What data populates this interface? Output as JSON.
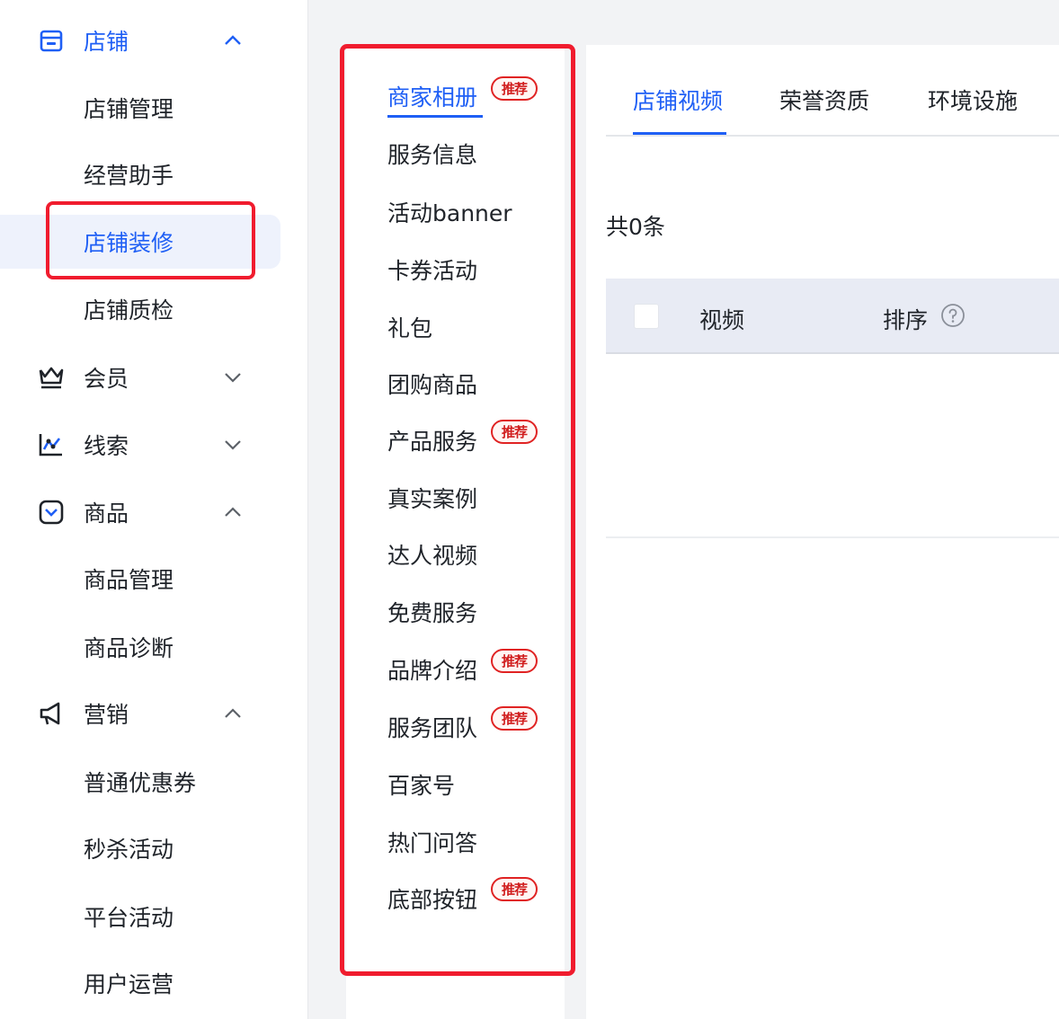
{
  "sidebar": {
    "groups": [
      {
        "label": "店铺",
        "icon": "store-icon",
        "expanded": true,
        "items": [
          {
            "label": "店铺管理"
          },
          {
            "label": "经营助手"
          },
          {
            "label": "店铺装修",
            "selected": true
          },
          {
            "label": "店铺质检"
          }
        ]
      },
      {
        "label": "会员",
        "icon": "crown-icon",
        "expanded": false
      },
      {
        "label": "线索",
        "icon": "chart-icon",
        "expanded": false
      },
      {
        "label": "商品",
        "icon": "product-icon",
        "expanded": true,
        "items": [
          {
            "label": "商品管理"
          },
          {
            "label": "商品诊断"
          }
        ]
      },
      {
        "label": "营销",
        "icon": "megaphone-icon",
        "expanded": true,
        "items": [
          {
            "label": "普通优惠券"
          },
          {
            "label": "秒杀活动"
          },
          {
            "label": "平台活动"
          },
          {
            "label": "用户运营"
          }
        ]
      }
    ]
  },
  "module_list": {
    "badge_text": "推荐",
    "items": [
      {
        "label": "商家相册",
        "active": true,
        "recommended": true
      },
      {
        "label": "服务信息"
      },
      {
        "label": "活动banner"
      },
      {
        "label": "卡券活动"
      },
      {
        "label": "礼包"
      },
      {
        "label": "团购商品"
      },
      {
        "label": "产品服务",
        "recommended": true
      },
      {
        "label": "真实案例"
      },
      {
        "label": "达人视频"
      },
      {
        "label": "免费服务"
      },
      {
        "label": "品牌介绍",
        "recommended": true
      },
      {
        "label": "服务团队",
        "recommended": true
      },
      {
        "label": "百家号"
      },
      {
        "label": "热门问答"
      },
      {
        "label": "底部按钮",
        "recommended": true
      }
    ]
  },
  "content": {
    "tabs": [
      {
        "label": "店铺视频",
        "active": true
      },
      {
        "label": "荣誉资质"
      },
      {
        "label": "环境设施"
      }
    ],
    "count_text": "共0条",
    "table": {
      "columns": [
        "视频",
        "排序"
      ]
    }
  },
  "colors": {
    "accent": "#1f5ff5",
    "highlight_box": "#f01c2e",
    "badge": "#e02323",
    "selected_bg": "#eef2fc",
    "table_header_bg": "#e8ebf4"
  }
}
